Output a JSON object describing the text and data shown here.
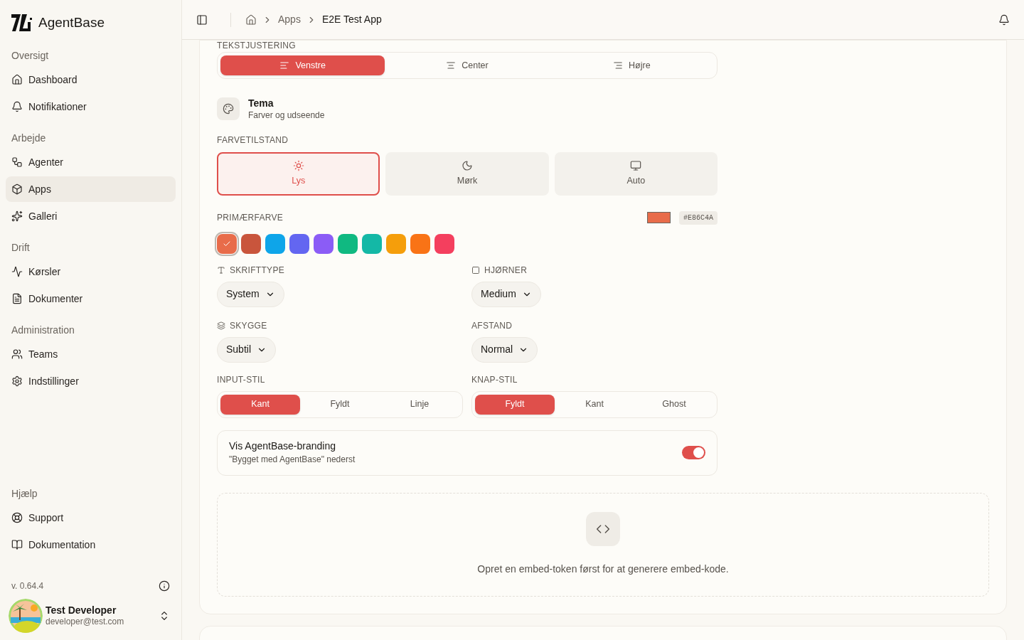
{
  "sidebar": {
    "brand": "AgentBase",
    "groups": [
      {
        "title": "Oversigt",
        "items": [
          {
            "label": "Dashboard",
            "selected": false
          },
          {
            "label": "Notifikationer",
            "selected": false
          }
        ]
      },
      {
        "title": "Arbejde",
        "items": [
          {
            "label": "Agenter",
            "selected": false
          },
          {
            "label": "Apps",
            "selected": true
          },
          {
            "label": "Galleri",
            "selected": false
          }
        ]
      },
      {
        "title": "Drift",
        "items": [
          {
            "label": "Kørsler",
            "selected": false
          },
          {
            "label": "Dokumenter",
            "selected": false
          }
        ]
      },
      {
        "title": "Administration",
        "items": [
          {
            "label": "Teams",
            "selected": false
          },
          {
            "label": "Indstillinger",
            "selected": false
          }
        ]
      }
    ],
    "help": {
      "title": "Hjælp",
      "items": [
        {
          "label": "Support",
          "selected": false
        },
        {
          "label": "Dokumentation",
          "selected": false
        }
      ]
    },
    "version": "v. 0.64.4",
    "user": {
      "name": "Test Developer",
      "email": "developer@test.com"
    }
  },
  "breadcrumb": [
    "Apps",
    "E2E Test App"
  ],
  "text_alignment": {
    "label": "TEKSTJUSTERING",
    "options": [
      {
        "label": "Venstre",
        "selected": true
      },
      {
        "label": "Center",
        "selected": false
      },
      {
        "label": "Højre",
        "selected": false
      }
    ]
  },
  "theme": {
    "title": "Tema",
    "subtitle": "Farver og udseende"
  },
  "color_mode": {
    "label": "FARVETILSTAND",
    "options": [
      {
        "label": "Lys",
        "selected": true
      },
      {
        "label": "Mørk",
        "selected": false
      },
      {
        "label": "Auto",
        "selected": false
      }
    ]
  },
  "primary_color": {
    "label": "PRIMÆRFARVE",
    "value": "#E86C4A",
    "swatches": [
      {
        "color": "#e86c4a",
        "selected": true
      },
      {
        "color": "#c9553c",
        "selected": false
      },
      {
        "color": "#0ea5e9",
        "selected": false
      },
      {
        "color": "#6366f1",
        "selected": false
      },
      {
        "color": "#8b5cf6",
        "selected": false
      },
      {
        "color": "#10b981",
        "selected": false
      },
      {
        "color": "#14b8a6",
        "selected": false
      },
      {
        "color": "#f59e0b",
        "selected": false
      },
      {
        "color": "#f97316",
        "selected": false
      },
      {
        "color": "#f43f5e",
        "selected": false
      }
    ]
  },
  "selects": [
    {
      "label": "SKRIFTTYPE",
      "value": "System"
    },
    {
      "label": "HJØRNER",
      "value": "Medium"
    },
    {
      "label": "SKYGGE",
      "value": "Subtil"
    },
    {
      "label": "AFSTAND",
      "value": "Normal"
    }
  ],
  "segments": [
    {
      "label": "INPUT-STIL",
      "options": [
        {
          "label": "Kant",
          "selected": true
        },
        {
          "label": "Fyldt",
          "selected": false
        },
        {
          "label": "Linje",
          "selected": false
        }
      ]
    },
    {
      "label": "KNAP-STIL",
      "options": [
        {
          "label": "Fyldt",
          "selected": true
        },
        {
          "label": "Kant",
          "selected": false
        },
        {
          "label": "Ghost",
          "selected": false
        }
      ]
    }
  ],
  "branding": {
    "title": "Vis AgentBase-branding",
    "subtitle": "\"Bygget med AgentBase\" nederst",
    "on": true
  },
  "embed": {
    "message": "Opret en embed-token først for at generere embed-kode."
  }
}
